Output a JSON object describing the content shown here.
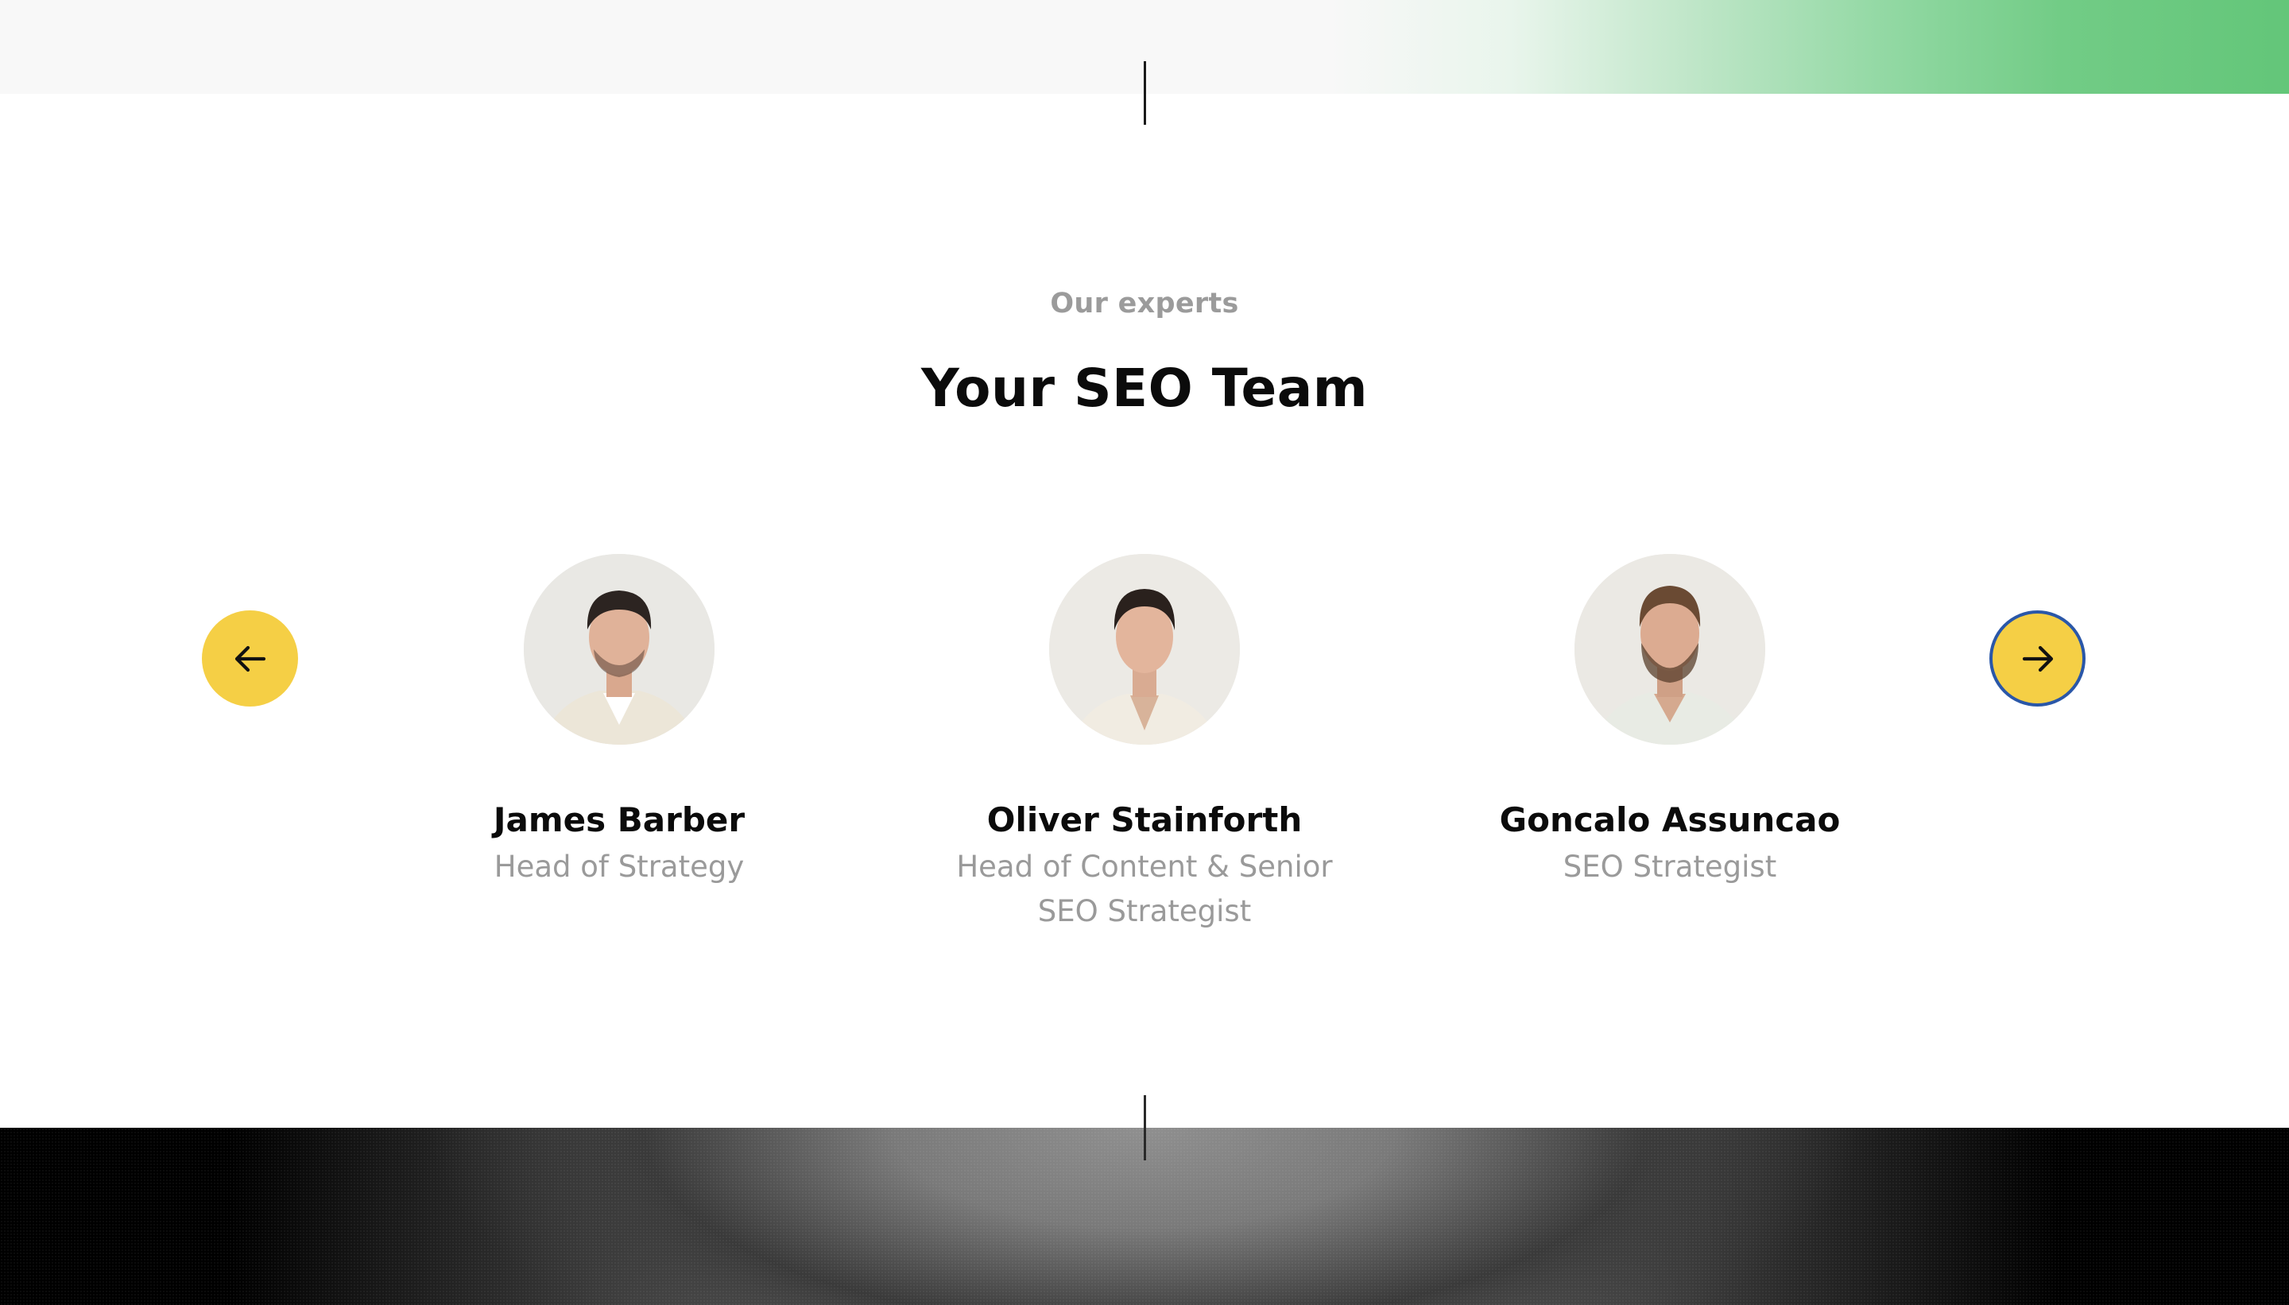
{
  "section": {
    "eyebrow": "Our experts",
    "title": "Your SEO Team"
  },
  "carousel": {
    "prev_icon": "arrow-left-icon",
    "next_icon": "arrow-right-icon",
    "button_color": "#f5cf45",
    "focus_ring_color": "#2a57a8"
  },
  "team": [
    {
      "name": "James Barber",
      "role": "Head of Strategy"
    },
    {
      "name": "Oliver Stainforth",
      "role": "Head of Content & Senior SEO Strategist"
    },
    {
      "name": "Goncalo Assuncao",
      "role": "SEO Strategist"
    }
  ],
  "colors": {
    "accent_green": "#63c679",
    "heading": "#0b0b0b",
    "muted": "#9a9a9a"
  }
}
